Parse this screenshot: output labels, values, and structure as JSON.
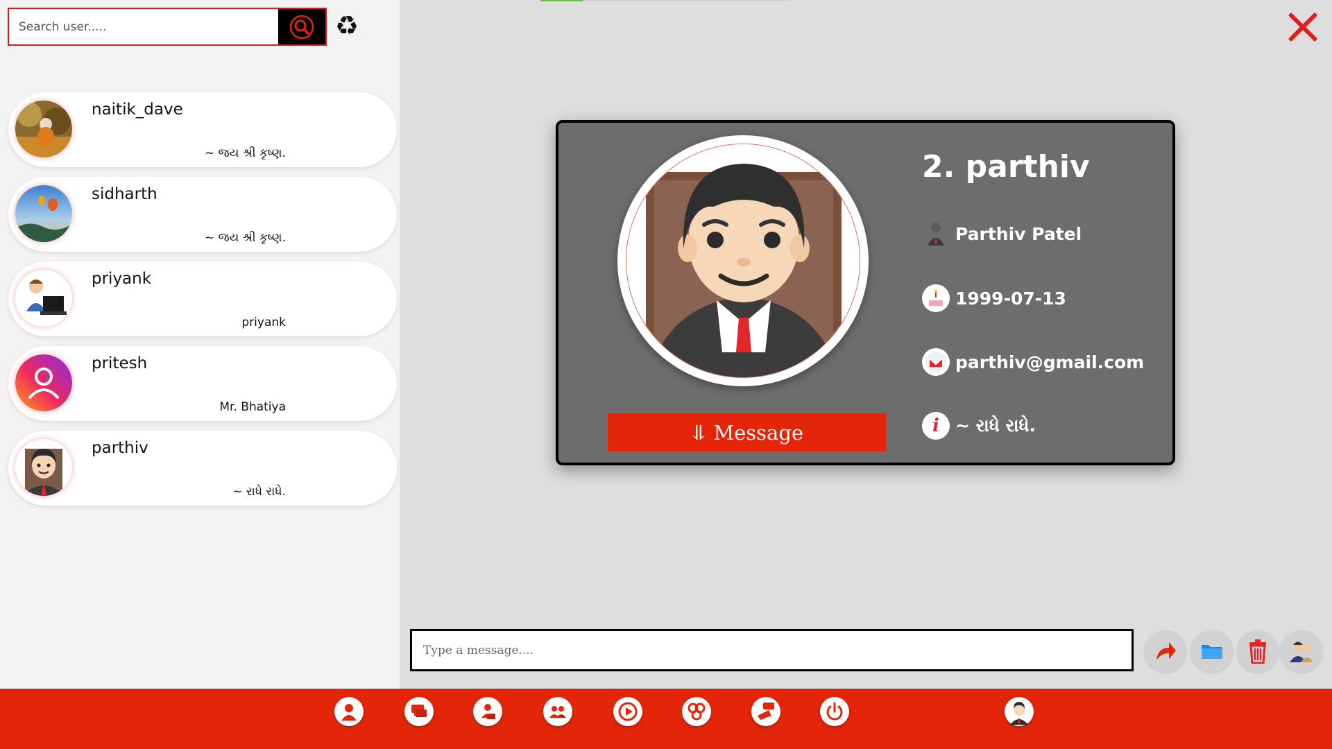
{
  "search": {
    "placeholder": "Search user....."
  },
  "contacts": [
    {
      "name": "naitik_dave",
      "status": "~ જય શ્રી કૃષ્ણ."
    },
    {
      "name": "sidharth",
      "status": "~ જય શ્રી કૃષ્ણ."
    },
    {
      "name": "priyank",
      "status": "priyank"
    },
    {
      "name": "pritesh",
      "status": "Mr. Bhatiya"
    },
    {
      "name": "parthiv",
      "status": "~ રાધે રાધે."
    }
  ],
  "profile": {
    "title": "2. parthiv",
    "full_name": "Parthiv Patel",
    "birthdate": "1999-07-13",
    "email": "parthiv@gmail.com",
    "about": "~ રાધે રાધે.",
    "message_button": "⥥ Message"
  },
  "composer": {
    "placeholder": "Type a message...."
  },
  "loading_progress": 0.17,
  "colors": {
    "accent": "#e3260a",
    "card": "#6e6d6e",
    "main_bg": "#dedede",
    "sidebar_bg": "#f3f3f3"
  }
}
